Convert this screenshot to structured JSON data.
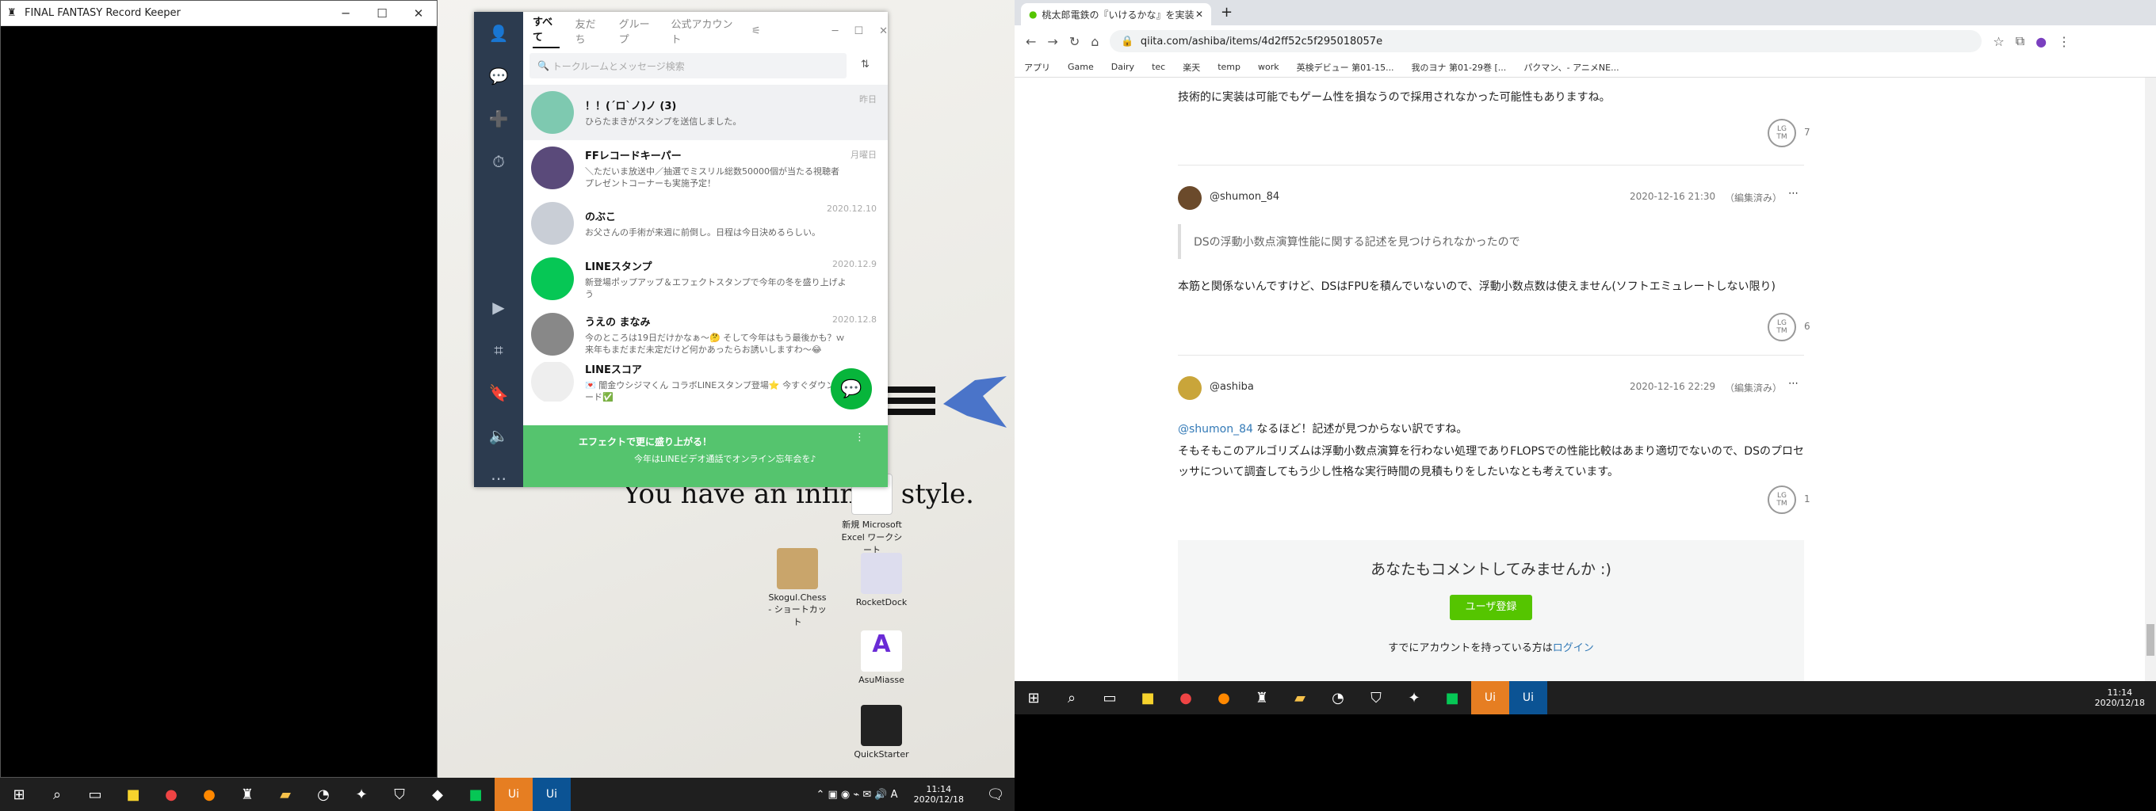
{
  "ff": {
    "title": "FINAL FANTASY Record Keeper",
    "min": "─",
    "max": "☐",
    "close": "✕"
  },
  "line": {
    "tabs": [
      "すべて",
      "友だち",
      "グループ",
      "公式アカウント"
    ],
    "search_placeholder": "トークルームとメッセージ検索",
    "chats": [
      {
        "name": "！！(´ロ`ノ)ノ (3)",
        "msg": "ひらたまきがスタンプを送信しました。",
        "date": "昨日",
        "color": "#7ec9b0"
      },
      {
        "name": "FFレコードキーパー",
        "msg": "＼ただいま放送中／抽選でミスリル総数50000個が当たる視聴者プレゼントコーナーも実施予定！",
        "date": "月曜日",
        "color": "#5a4a7a"
      },
      {
        "name": "のぶこ",
        "msg": "お父さんの手術が来週に前倒し。日程は今日決めるらしい。",
        "date": "2020.12.10",
        "color": "#c9ced6"
      },
      {
        "name": "LINEスタンプ",
        "msg": "新登場ポップアップ＆エフェクトスタンプで今年の冬を盛り上げよう",
        "date": "2020.12.9",
        "color": "#06c755"
      },
      {
        "name": "うえの まなみ",
        "msg": "今のところは19日だけかなぁ〜🤔 そして今年はもう最後かも？ｗ 来年もまだまだ未定だけど何かあったらお誘いしますわ〜😂",
        "date": "2020.12.8",
        "color": "#888"
      },
      {
        "name": "LINEスコア",
        "msg": "💌 闇金ウシジマくん コラボLINEスタンプ登場⭐ 今すぐダウンロード✅",
        "date": "",
        "color": "#eee"
      }
    ],
    "banner_title": "エフェクトで更に盛り上がる！",
    "banner_text": "今年はLINEビデオ通話でオンライン忘年会を♪"
  },
  "desktop": {
    "wallpaper_text": "You have an infinite style.",
    "icons": [
      "新規 Microsoft Excel ワークシート",
      "Skogul.Chess - ショートカット",
      "RocketDock",
      "AsuMiasse",
      "QuickStarter"
    ]
  },
  "taskbar_left": {
    "time": "11:14",
    "date": "2020/12/18"
  },
  "browser": {
    "tab_title": "桃太郎電鉄の『いけるかな』を実装…",
    "url": "qiita.com/ashiba/items/4d2ff52c5f295018057e",
    "bookmarks": [
      "アプリ",
      "Game",
      "Dairy",
      "tec",
      "楽天",
      "temp",
      "work",
      "英検デビュー 第01-15...",
      "我のヨナ 第01-29巻 [...",
      "パクマン、- アニメNE..."
    ],
    "top_text": "技術的に実装は可能でもゲーム性を損なうので採用されなかった可能性もありますね。",
    "top_lgtm": "7",
    "comments": [
      {
        "user": "@shumon_84",
        "date": "2020-12-16 21:30",
        "edited": "（編集済み）",
        "quote": "DSの浮動小数点演算性能に関する記述を見つけられなかったので",
        "body": "本筋と関係ないんですけど、DSはFPUを積んでいないので、浮動小数点数は使えません(ソフトエミュレートしない限り)",
        "lgtm": "6"
      },
      {
        "user": "@ashiba",
        "date": "2020-12-16 22:29",
        "edited": "（編集済み）",
        "mention": "@shumon_84",
        "body1": " なるほど！記述が見つからない訳ですね。",
        "body2": "そもそもこのアルゴリズムは浮動小数点演算を行わない処理でありFLOPSでの性能比較はあまり適切でないので、DSのプロセッサについて調査してもう少し性格な実行時間の見積もりをしたいなとも考えています。",
        "lgtm": "1"
      }
    ],
    "cta_title": "あなたもコメントしてみませんか :)",
    "cta_button": "ユーザ登録",
    "cta_login_pre": "すでにアカウントを持っている方は",
    "cta_login": "ログイン"
  },
  "taskbar_right": {
    "time": "11:14",
    "date": "2020/12/18"
  },
  "colors": {
    "line_green": "#06c755",
    "qiita_green": "#55c500",
    "link": "#337ab7"
  }
}
